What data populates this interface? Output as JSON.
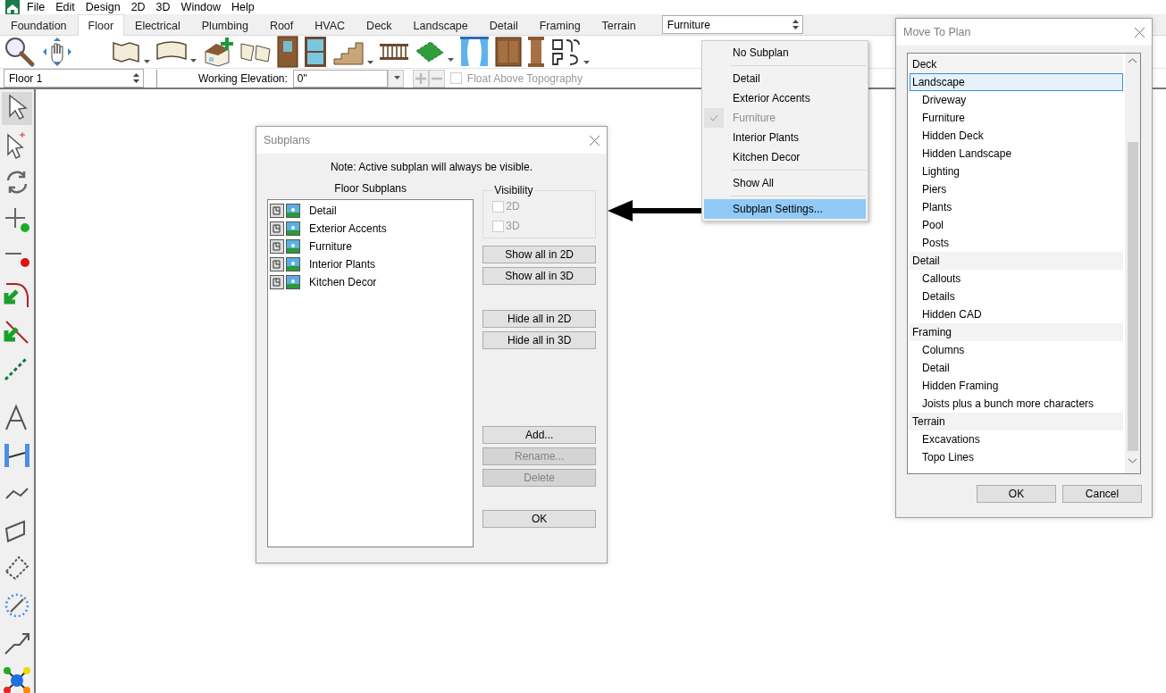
{
  "menu_bar": {
    "items": [
      "File",
      "Edit",
      "Design",
      "2D",
      "3D",
      "Window",
      "Help"
    ]
  },
  "tabs": [
    {
      "label": "Foundation",
      "selected": false
    },
    {
      "label": "Floor",
      "selected": true
    },
    {
      "label": "Electrical",
      "selected": false
    },
    {
      "label": "Plumbing",
      "selected": false
    },
    {
      "label": "Roof",
      "selected": false
    },
    {
      "label": "HVAC",
      "selected": false
    },
    {
      "label": "Deck",
      "selected": false
    },
    {
      "label": "Landscape",
      "selected": false
    },
    {
      "label": "Detail",
      "selected": false
    },
    {
      "label": "Framing",
      "selected": false
    },
    {
      "label": "Terrain",
      "selected": false
    }
  ],
  "subplan_select": {
    "value": "Furniture"
  },
  "floor_select": {
    "value": "Floor 1"
  },
  "working_elevation": {
    "label": "Working Elevation:",
    "value": "0\""
  },
  "float_above": {
    "label": "Float Above Topography",
    "checked": false,
    "disabled": true
  },
  "subplan_menu": {
    "groups": [
      [
        {
          "label": "No Subplan",
          "checked": false,
          "disabled": false,
          "selected": false
        }
      ],
      [
        {
          "label": "Detail",
          "checked": false,
          "disabled": false,
          "selected": false
        },
        {
          "label": "Exterior Accents",
          "checked": false,
          "disabled": false,
          "selected": false
        },
        {
          "label": "Furniture",
          "checked": true,
          "disabled": true,
          "selected": false
        },
        {
          "label": "Interior Plants",
          "checked": false,
          "disabled": false,
          "selected": false
        },
        {
          "label": "Kitchen Decor",
          "checked": false,
          "disabled": false,
          "selected": false
        }
      ],
      [
        {
          "label": "Show All",
          "checked": false,
          "disabled": false,
          "selected": false
        }
      ],
      [
        {
          "label": "Subplan Settings...",
          "checked": false,
          "disabled": false,
          "selected": true
        }
      ]
    ]
  },
  "subplans_dialog": {
    "title": "Subplans",
    "note": "Note: Active subplan will always be visible.",
    "list_heading": "Floor Subplans",
    "items": [
      "Detail",
      "Exterior Accents",
      "Furniture",
      "Interior Plants",
      "Kitchen Decor"
    ],
    "visibility": {
      "label": "Visibility",
      "options": [
        {
          "label": "2D",
          "checked": false,
          "disabled": true
        },
        {
          "label": "3D",
          "checked": false,
          "disabled": true
        }
      ]
    },
    "button_groups": [
      [
        {
          "label": "Show all in 2D",
          "disabled": false
        },
        {
          "label": "Show all in 3D",
          "disabled": false
        }
      ],
      [
        {
          "label": "Hide all in 2D",
          "disabled": false
        },
        {
          "label": "Hide all in 3D",
          "disabled": false
        }
      ],
      [
        {
          "label": "Add...",
          "disabled": false
        },
        {
          "label": "Rename...",
          "disabled": true
        },
        {
          "label": "Delete",
          "disabled": true
        }
      ],
      [
        {
          "label": "OK",
          "disabled": false
        }
      ]
    ]
  },
  "move_to_plan": {
    "title": "Move To Plan",
    "items": [
      {
        "label": "Deck",
        "selected": false
      },
      {
        "label": "Landscape",
        "selected": true,
        "children": [
          {
            "label": "Driveway",
            "selected": false
          },
          {
            "label": "Furniture",
            "selected": false
          },
          {
            "label": "Hidden Deck",
            "selected": false
          },
          {
            "label": "Hidden Landscape",
            "selected": false
          },
          {
            "label": "Lighting",
            "selected": false
          },
          {
            "label": "Piers",
            "selected": false
          },
          {
            "label": "Plants",
            "selected": false
          },
          {
            "label": "Pool",
            "selected": false
          },
          {
            "label": "Posts",
            "selected": false
          }
        ]
      },
      {
        "label": "Detail",
        "selected": false,
        "children": [
          {
            "label": "Callouts",
            "selected": false
          },
          {
            "label": "Details",
            "selected": false
          },
          {
            "label": "Hidden CAD",
            "selected": false
          }
        ]
      },
      {
        "label": "Framing",
        "selected": false,
        "children": [
          {
            "label": "Columns",
            "selected": false
          },
          {
            "label": "Detail",
            "selected": false
          },
          {
            "label": "Hidden Framing",
            "selected": false
          },
          {
            "label": "Joists plus a bunch more characters",
            "selected": false
          }
        ]
      },
      {
        "label": "Terrain",
        "selected": false,
        "children": [
          {
            "label": "Excavations",
            "selected": false
          },
          {
            "label": "Topo Lines",
            "selected": false
          }
        ]
      }
    ],
    "buttons": [
      "OK",
      "Cancel"
    ]
  }
}
